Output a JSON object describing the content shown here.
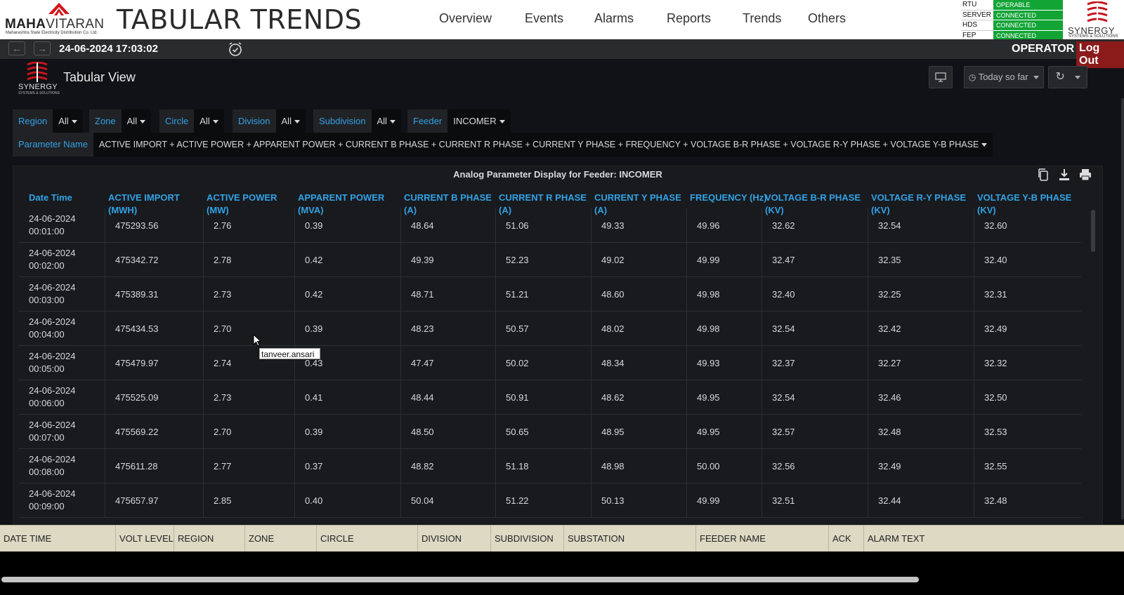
{
  "header": {
    "logo_brand_bold": "MAHA",
    "logo_brand_rest": "VITARAN",
    "logo_subtitle": "Maharashtra State Electricity Distribution Co. Ltd.",
    "title": "TABULAR TRENDS",
    "nav": [
      "Overview",
      "Events",
      "Alarms",
      "Reports",
      "Trends",
      "Others"
    ],
    "status": [
      {
        "key": "RTU",
        "value": "OPERABLE"
      },
      {
        "key": "SERVER",
        "value": "CONNECTED"
      },
      {
        "key": "HDS",
        "value": "CONNECTED"
      },
      {
        "key": "FEP",
        "value": "CONNECTED"
      }
    ],
    "status_color": "#13a436",
    "synergy_logo": "SYNERGY",
    "synergy_sub": "SYSTEMS & SOLUTIONS"
  },
  "subbar": {
    "datetime": "24-06-2024 17:03:02",
    "role": "OPERATOR",
    "logout": "Log Out"
  },
  "dashboard": {
    "logo_text": "SYNERGY",
    "logo_sub": "SYSTEMS & SOLUTIONS",
    "title": "Tabular View",
    "time_range": "Today so far"
  },
  "variables": [
    {
      "label": "Region",
      "value": "All"
    },
    {
      "label": "Zone",
      "value": "All"
    },
    {
      "label": "Circle",
      "value": "All"
    },
    {
      "label": "Division",
      "value": "All"
    },
    {
      "label": "Subdivision",
      "value": "All"
    },
    {
      "label": "Feeder",
      "value": "INCOMER"
    }
  ],
  "parameter": {
    "label": "Parameter Name",
    "value": "ACTIVE IMPORT + ACTIVE POWER + APPARENT POWER + CURRENT B PHASE + CURRENT R PHASE + CURRENT Y PHASE + FREQUENCY + VOLTAGE B-R PHASE + VOLTAGE R-Y PHASE + VOLTAGE Y-B PHASE"
  },
  "panel": {
    "title": "Analog Parameter Display for Feeder: INCOMER",
    "columns": [
      "Date Time",
      "ACTIVE IMPORT (MWH)",
      "ACTIVE POWER (MW)",
      "APPARENT POWER (MVA)",
      "CURRENT B PHASE (A)",
      "CURRENT R PHASE (A)",
      "CURRENT Y PHASE (A)",
      "FREQUENCY (Hz)",
      "VOLTAGE B-R PHASE (KV)",
      "VOLTAGE R-Y PHASE (KV)",
      "VOLTAGE Y-B PHASE (KV)"
    ],
    "rows": [
      {
        "date": "24-06-2024",
        "time": "00:01:00",
        "values": [
          "475293.56",
          "2.76",
          "0.39",
          "48.64",
          "51.06",
          "49.33",
          "49.96",
          "32.62",
          "32.54",
          "32.60"
        ]
      },
      {
        "date": "24-06-2024",
        "time": "00:02:00",
        "values": [
          "475342.72",
          "2.78",
          "0.42",
          "49.39",
          "52.23",
          "49.02",
          "49.99",
          "32.47",
          "32.35",
          "32.40"
        ]
      },
      {
        "date": "24-06-2024",
        "time": "00:03:00",
        "values": [
          "475389.31",
          "2.73",
          "0.42",
          "48.71",
          "51.21",
          "48.60",
          "49.98",
          "32.40",
          "32.25",
          "32.31"
        ]
      },
      {
        "date": "24-06-2024",
        "time": "00:04:00",
        "values": [
          "475434.53",
          "2.70",
          "0.39",
          "48.23",
          "50.57",
          "48.02",
          "49.98",
          "32.54",
          "32.42",
          "32.49"
        ]
      },
      {
        "date": "24-06-2024",
        "time": "00:05:00",
        "values": [
          "475479.97",
          "2.74",
          "0.43",
          "47.47",
          "50.02",
          "48.34",
          "49.93",
          "32.37",
          "32.27",
          "32.32"
        ]
      },
      {
        "date": "24-06-2024",
        "time": "00:06:00",
        "values": [
          "475525.09",
          "2.73",
          "0.41",
          "48.44",
          "50.91",
          "48.62",
          "49.95",
          "32.54",
          "32.46",
          "32.50"
        ]
      },
      {
        "date": "24-06-2024",
        "time": "00:07:00",
        "values": [
          "475569.22",
          "2.70",
          "0.39",
          "48.50",
          "50.65",
          "48.95",
          "49.95",
          "32.57",
          "32.48",
          "32.53"
        ]
      },
      {
        "date": "24-06-2024",
        "time": "00:08:00",
        "values": [
          "475611.28",
          "2.77",
          "0.37",
          "48.82",
          "51.18",
          "48.98",
          "50.00",
          "32.56",
          "32.49",
          "32.55"
        ]
      },
      {
        "date": "24-06-2024",
        "time": "00:09:00",
        "values": [
          "475657.97",
          "2.85",
          "0.40",
          "50.04",
          "51.22",
          "50.13",
          "49.99",
          "32.51",
          "32.44",
          "32.48"
        ]
      }
    ]
  },
  "tooltip": "tanveer.ansari",
  "alarm_columns": [
    "DATE TIME",
    "VOLT LEVEL",
    "REGION",
    "ZONE",
    "CIRCLE",
    "DIVISION",
    "SUBDIVISION",
    "SUBSTATION",
    "FEEDER NAME",
    "ACK",
    "ALARM TEXT"
  ],
  "colors": {
    "accent": "#33a2e5",
    "logout": "#8b1a1a",
    "alarm_bar": "#ddd9c3"
  }
}
